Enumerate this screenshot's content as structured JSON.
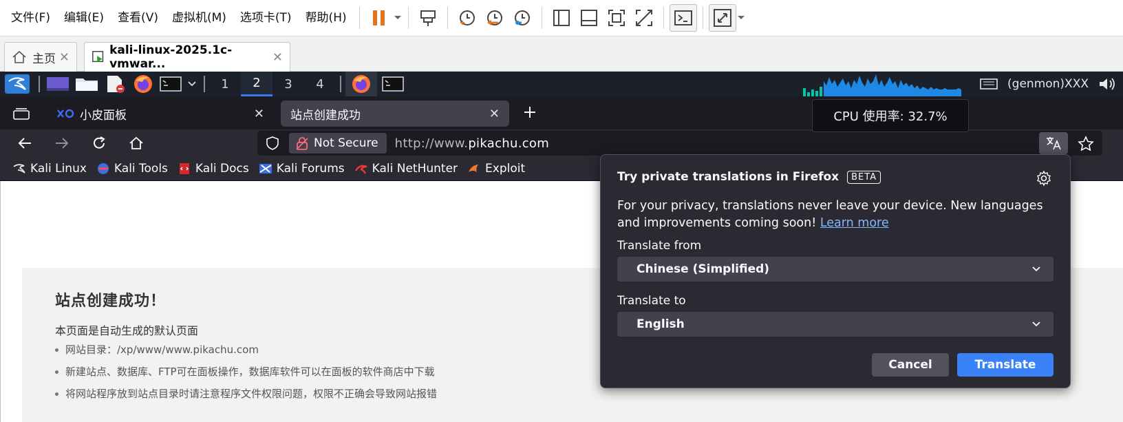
{
  "vmware": {
    "menu": [
      "文件(F)",
      "编辑(E)",
      "查看(V)",
      "虚拟机(M)",
      "选项卡(T)",
      "帮助(H)"
    ],
    "tabs": [
      {
        "label": "主页"
      },
      {
        "label": "kali-linux-2025.1c-vmwar..."
      }
    ],
    "colors": {
      "pause_accent": "#e8731f"
    }
  },
  "xfce": {
    "workspaces": [
      "1",
      "2",
      "3",
      "4"
    ],
    "active_workspace": "2",
    "genmon": "(genmon)XXX",
    "cpu_tooltip": "CPU 使用率: 32.7%"
  },
  "firefox": {
    "tabs": [
      {
        "label": "小皮面板"
      },
      {
        "label": "站点创建成功"
      }
    ],
    "security_label": "Not Secure",
    "url_prefix": "http://www.",
    "url_domain": "pikachu.com",
    "bookmarks": [
      "Kali Linux",
      "Kali Tools",
      "Kali Docs",
      "Kali Forums",
      "Kali NetHunter",
      "Exploit"
    ]
  },
  "page": {
    "title": "站点创建成功！",
    "subtitle": "本页面是自动生成的默认页面",
    "items": [
      "网站目录：/xp/www/www.pikachu.com",
      "新建站点、数据库、FTP可在面板操作，数据库软件可以在面板的软件商店中下载",
      "将网站程序放到站点目录时请注意程序文件权限问题，权限不正确会导致网站报错"
    ]
  },
  "translation_panel": {
    "title": "Try private translations in Firefox",
    "badge": "BETA",
    "description": "For your privacy, translations never leave your device. New languages and improvements coming soon!",
    "learn_more": "Learn more",
    "from_label": "Translate from",
    "from_value": "Chinese (Simplified)",
    "to_label": "Translate to",
    "to_value": "English",
    "cancel": "Cancel",
    "translate": "Translate"
  }
}
